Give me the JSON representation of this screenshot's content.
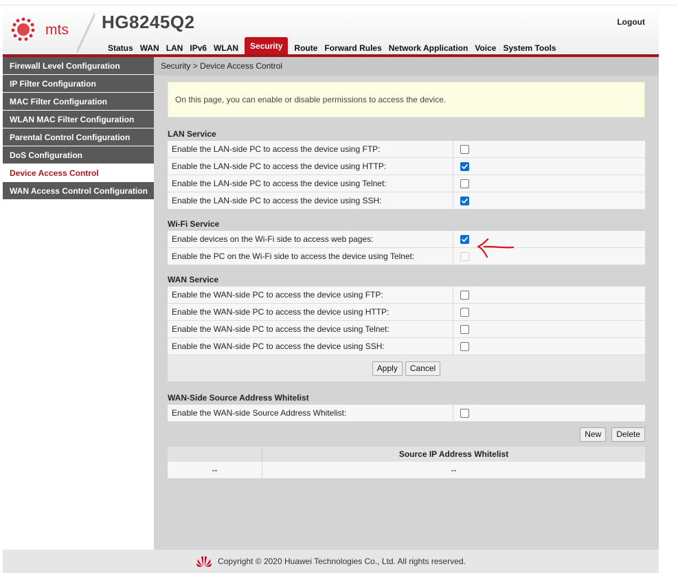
{
  "header": {
    "logo_text": "mts",
    "model": "HG8245Q2",
    "logout": "Logout"
  },
  "nav": {
    "items": [
      {
        "label": "Status"
      },
      {
        "label": "WAN"
      },
      {
        "label": "LAN"
      },
      {
        "label": "IPv6"
      },
      {
        "label": "WLAN"
      },
      {
        "label": "Security"
      },
      {
        "label": "Route"
      },
      {
        "label": "Forward Rules"
      },
      {
        "label": "Network Application"
      },
      {
        "label": "Voice"
      },
      {
        "label": "System Tools"
      }
    ],
    "active": "Security"
  },
  "sidebar": {
    "items": [
      {
        "label": "Firewall Level Configuration"
      },
      {
        "label": "IP Filter Configuration"
      },
      {
        "label": "MAC Filter Configuration"
      },
      {
        "label": "WLAN MAC Filter Configuration"
      },
      {
        "label": "Parental Control Configuration"
      },
      {
        "label": "DoS Configuration"
      },
      {
        "label": "Device Access Control"
      },
      {
        "label": "WAN Access Control Configuration"
      }
    ],
    "active": "Device Access Control"
  },
  "breadcrumb": "Security > Device Access Control",
  "info": "On this page, you can enable or disable permissions to access the device.",
  "lan": {
    "title": "LAN Service",
    "rows": [
      {
        "label": "Enable the LAN-side PC to access the device using FTP:",
        "checked": false
      },
      {
        "label": "Enable the LAN-side PC to access the device using HTTP:",
        "checked": true
      },
      {
        "label": "Enable the LAN-side PC to access the device using Telnet:",
        "checked": false
      },
      {
        "label": "Enable the LAN-side PC to access the device using SSH:",
        "checked": true
      }
    ]
  },
  "wifi": {
    "title": "Wi-Fi Service",
    "rows": [
      {
        "label": "Enable devices on the Wi-Fi side to access web pages:",
        "checked": true
      },
      {
        "label": "Enable the PC on the Wi-Fi side to access the device using Telnet:",
        "checked": false,
        "disabled": true
      }
    ]
  },
  "wan": {
    "title": "WAN Service",
    "rows": [
      {
        "label": "Enable the WAN-side PC to access the device using FTP:",
        "checked": false
      },
      {
        "label": "Enable the WAN-side PC to access the device using HTTP:",
        "checked": false
      },
      {
        "label": "Enable the WAN-side PC to access the device using Telnet:",
        "checked": false
      },
      {
        "label": "Enable the WAN-side PC to access the device using SSH:",
        "checked": false
      }
    ]
  },
  "buttons": {
    "apply": "Apply",
    "cancel": "Cancel",
    "new": "New",
    "delete": "Delete"
  },
  "whitelist": {
    "title": "WAN-Side Source Address Whitelist",
    "row": {
      "label": "Enable the WAN-side Source Address Whitelist:",
      "checked": false
    },
    "table": {
      "header": "Source IP Address Whitelist",
      "cells": [
        "--",
        "--"
      ]
    }
  },
  "colors": {
    "accent": "#c1121c",
    "checkbox_checked": "#0a6ed1",
    "annotation": "#e0131c"
  },
  "footer": "Copyright © 2020 Huawei Technologies Co., Ltd. All rights reserved."
}
